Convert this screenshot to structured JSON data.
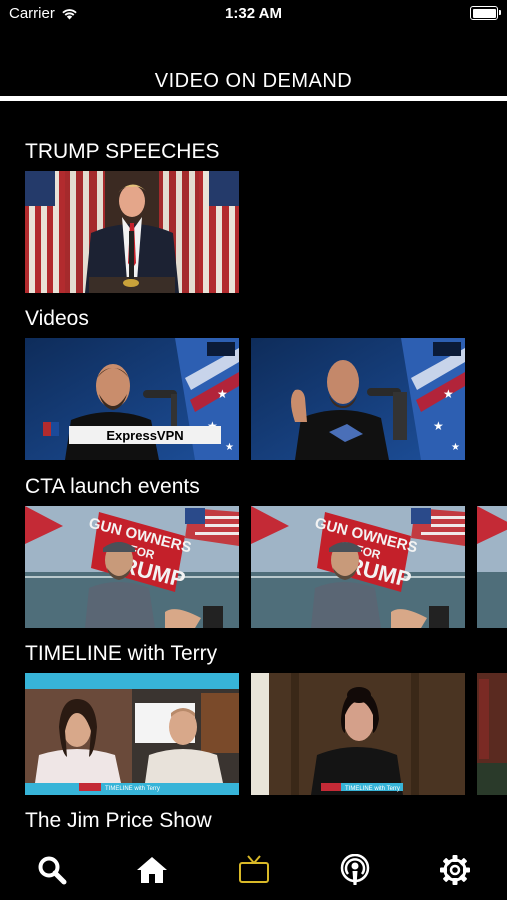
{
  "status_bar": {
    "carrier": "Carrier",
    "time": "1:32 AM"
  },
  "header": {
    "title": "VIDEO ON DEMAND"
  },
  "sections": [
    {
      "title": "TRUMP SPEECHES"
    },
    {
      "title": "Videos",
      "overlays": {
        "sponsor": "ExpressVPN"
      }
    },
    {
      "title": "CTA launch events",
      "overlays": {
        "banner_line1": "GUN OWNERS",
        "banner_line2": "FOR",
        "banner_line3": "TRUMP"
      }
    },
    {
      "title": "TIMELINE with Terry",
      "overlays": {
        "lower_third": "TIMELINE with Terry"
      }
    },
    {
      "title": "The Jim Price Show"
    }
  ],
  "tabs": [
    {
      "name": "search-tab",
      "icon": "search-icon",
      "active": false
    },
    {
      "name": "home-tab",
      "icon": "home-icon",
      "active": false
    },
    {
      "name": "tv-tab",
      "icon": "tv-icon",
      "active": true
    },
    {
      "name": "podcast-tab",
      "icon": "podcast-icon",
      "active": false
    },
    {
      "name": "settings-tab",
      "icon": "gear-icon",
      "active": false
    }
  ],
  "colors": {
    "background": "#000000",
    "text": "#ffffff",
    "active_tab": "#d9b928",
    "inactive_tab": "#ffffff"
  }
}
